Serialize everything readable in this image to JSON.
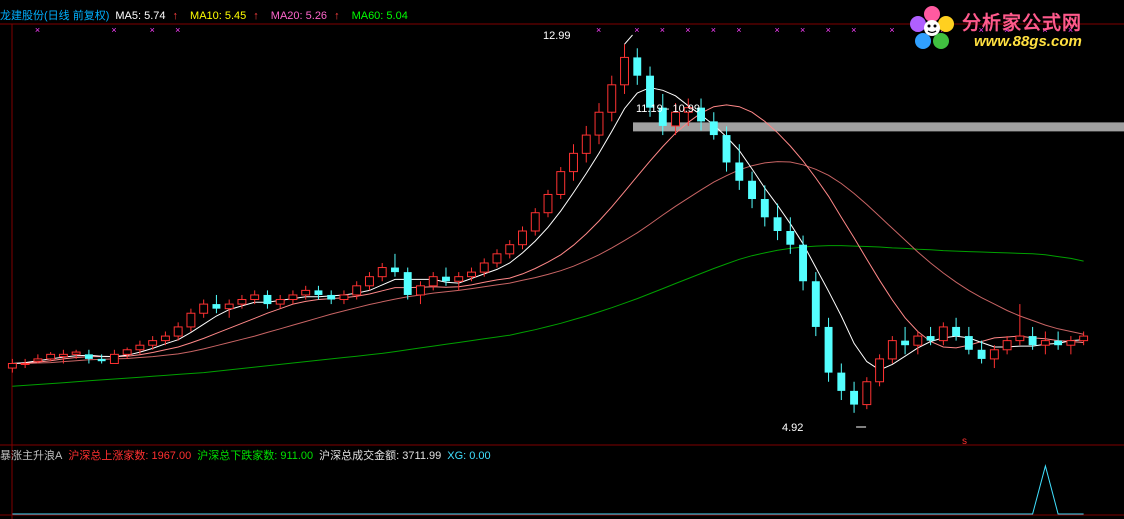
{
  "header": {
    "stock_name": "龙建股份(日线 前复权)",
    "ma5_label": "MA5: 5.74",
    "ma10_label": "MA10: 5.45",
    "ma20_label": "MA20: 5.26",
    "ma60_label": "MA60: 5.04",
    "arrow_glyph": "↑"
  },
  "logo": {
    "brand": "分析家公式网",
    "url": "www.88gs.com",
    "icon": "flower-logo-icon"
  },
  "indicator": {
    "title": "暴涨主升浪A",
    "up_label": "沪深总上涨家数: 1967.00",
    "down_label": "沪深总下跌家数: 911.00",
    "amount_label": "沪深总成交金额: 3711.99",
    "xg_label": "XG: 0.00"
  },
  "annotations": {
    "high": "12.99",
    "low": "4.92",
    "range": "11.19 - 10.99",
    "marker": "s"
  },
  "colors": {
    "bull": "#ff3232",
    "bear": "#54ffff",
    "ma5": "#ffffff",
    "ma10": "#ff8888",
    "ma20": "#c86464",
    "ma60": "#00a000",
    "grid": "#800000",
    "xmark": "#ff40ff",
    "band": "#a0a0a0",
    "xg_line": "#40e0ff"
  },
  "chart_data": {
    "type": "candlestick",
    "ylim": [
      4.5,
      13.3
    ],
    "candles": [
      [
        5.9,
        6.1,
        5.8,
        6.0
      ],
      [
        6.0,
        6.1,
        5.9,
        6.0
      ],
      [
        6.05,
        6.2,
        6.0,
        6.1
      ],
      [
        6.1,
        6.25,
        6.05,
        6.2
      ],
      [
        6.15,
        6.3,
        6.0,
        6.2
      ],
      [
        6.2,
        6.3,
        6.1,
        6.25
      ],
      [
        6.2,
        6.3,
        6.0,
        6.1
      ],
      [
        6.1,
        6.2,
        6.0,
        6.05
      ],
      [
        6.0,
        6.3,
        6.0,
        6.2
      ],
      [
        6.2,
        6.35,
        6.1,
        6.3
      ],
      [
        6.3,
        6.5,
        6.2,
        6.4
      ],
      [
        6.4,
        6.6,
        6.3,
        6.5
      ],
      [
        6.5,
        6.7,
        6.4,
        6.6
      ],
      [
        6.6,
        6.9,
        6.5,
        6.8
      ],
      [
        6.8,
        7.2,
        6.7,
        7.1
      ],
      [
        7.1,
        7.4,
        7.0,
        7.3
      ],
      [
        7.3,
        7.5,
        7.1,
        7.2
      ],
      [
        7.2,
        7.4,
        7.0,
        7.3
      ],
      [
        7.3,
        7.5,
        7.2,
        7.4
      ],
      [
        7.4,
        7.6,
        7.3,
        7.5
      ],
      [
        7.5,
        7.6,
        7.2,
        7.3
      ],
      [
        7.3,
        7.5,
        7.2,
        7.4
      ],
      [
        7.4,
        7.6,
        7.3,
        7.5
      ],
      [
        7.5,
        7.7,
        7.4,
        7.6
      ],
      [
        7.6,
        7.7,
        7.4,
        7.5
      ],
      [
        7.5,
        7.6,
        7.3,
        7.4
      ],
      [
        7.4,
        7.6,
        7.3,
        7.5
      ],
      [
        7.5,
        7.8,
        7.4,
        7.7
      ],
      [
        7.7,
        8.0,
        7.6,
        7.9
      ],
      [
        7.9,
        8.2,
        7.8,
        8.1
      ],
      [
        8.1,
        8.4,
        7.9,
        8.0
      ],
      [
        8.0,
        8.1,
        7.4,
        7.5
      ],
      [
        7.5,
        7.8,
        7.3,
        7.7
      ],
      [
        7.7,
        8.0,
        7.6,
        7.9
      ],
      [
        7.9,
        8.1,
        7.7,
        7.8
      ],
      [
        7.8,
        8.0,
        7.6,
        7.9
      ],
      [
        7.9,
        8.1,
        7.8,
        8.0
      ],
      [
        8.0,
        8.3,
        7.9,
        8.2
      ],
      [
        8.2,
        8.5,
        8.1,
        8.4
      ],
      [
        8.4,
        8.7,
        8.3,
        8.6
      ],
      [
        8.6,
        9.0,
        8.5,
        8.9
      ],
      [
        8.9,
        9.4,
        8.8,
        9.3
      ],
      [
        9.3,
        9.8,
        9.2,
        9.7
      ],
      [
        9.7,
        10.3,
        9.6,
        10.2
      ],
      [
        10.2,
        10.8,
        10.0,
        10.6
      ],
      [
        10.6,
        11.2,
        10.4,
        11.0
      ],
      [
        11.0,
        11.7,
        10.8,
        11.5
      ],
      [
        11.5,
        12.3,
        11.3,
        12.1
      ],
      [
        12.1,
        12.99,
        11.9,
        12.7
      ],
      [
        12.7,
        12.9,
        12.1,
        12.3
      ],
      [
        12.3,
        12.5,
        11.4,
        11.6
      ],
      [
        11.6,
        11.9,
        11.0,
        11.2
      ],
      [
        11.2,
        11.7,
        11.0,
        11.5
      ],
      [
        11.5,
        11.8,
        11.2,
        11.6
      ],
      [
        11.6,
        11.8,
        11.1,
        11.3
      ],
      [
        11.3,
        11.5,
        10.9,
        11.0
      ],
      [
        11.0,
        11.19,
        10.2,
        10.4
      ],
      [
        10.4,
        10.8,
        9.8,
        10.0
      ],
      [
        10.0,
        10.2,
        9.4,
        9.6
      ],
      [
        9.6,
        9.9,
        9.0,
        9.2
      ],
      [
        9.2,
        9.5,
        8.7,
        8.9
      ],
      [
        8.9,
        9.2,
        8.4,
        8.6
      ],
      [
        8.6,
        8.8,
        7.6,
        7.8
      ],
      [
        7.8,
        8.0,
        6.6,
        6.8
      ],
      [
        6.8,
        7.0,
        5.6,
        5.8
      ],
      [
        5.8,
        6.0,
        5.2,
        5.4
      ],
      [
        5.4,
        5.6,
        4.92,
        5.1
      ],
      [
        5.1,
        5.7,
        5.0,
        5.6
      ],
      [
        5.6,
        6.2,
        5.5,
        6.1
      ],
      [
        6.1,
        6.6,
        6.0,
        6.5
      ],
      [
        6.5,
        6.8,
        6.2,
        6.4
      ],
      [
        6.4,
        6.7,
        6.2,
        6.6
      ],
      [
        6.6,
        6.8,
        6.4,
        6.5
      ],
      [
        6.5,
        6.9,
        6.4,
        6.8
      ],
      [
        6.8,
        7.0,
        6.5,
        6.6
      ],
      [
        6.6,
        6.8,
        6.2,
        6.3
      ],
      [
        6.3,
        6.5,
        6.0,
        6.1
      ],
      [
        6.1,
        6.4,
        5.9,
        6.3
      ],
      [
        6.3,
        6.6,
        6.2,
        6.5
      ],
      [
        6.5,
        7.3,
        6.4,
        6.6
      ],
      [
        6.6,
        6.8,
        6.3,
        6.4
      ],
      [
        6.4,
        6.7,
        6.2,
        6.5
      ],
      [
        6.5,
        6.7,
        6.3,
        6.4
      ],
      [
        6.4,
        6.6,
        6.2,
        6.5
      ],
      [
        6.5,
        6.7,
        6.4,
        6.6
      ]
    ],
    "ma5": [
      6.0,
      6.02,
      6.06,
      6.1,
      6.14,
      6.17,
      6.18,
      6.16,
      6.15,
      6.18,
      6.25,
      6.33,
      6.43,
      6.52,
      6.68,
      6.86,
      7.04,
      7.18,
      7.26,
      7.34,
      7.34,
      7.38,
      7.42,
      7.46,
      7.46,
      7.48,
      7.5,
      7.54,
      7.6,
      7.72,
      7.84,
      7.84,
      7.84,
      7.84,
      7.78,
      7.76,
      7.86,
      7.96,
      8.06,
      8.2,
      8.42,
      8.68,
      8.98,
      9.34,
      9.74,
      10.16,
      10.6,
      11.08,
      11.58,
      11.92,
      12.04,
      11.98,
      11.86,
      11.64,
      11.44,
      11.22,
      10.96,
      10.66,
      10.26,
      9.84,
      9.46,
      9.06,
      8.62,
      8.1,
      7.58,
      7.04,
      6.44,
      6.04,
      5.86,
      5.98,
      6.16,
      6.34,
      6.48,
      6.56,
      6.6,
      6.56,
      6.46,
      6.36,
      6.36,
      6.38,
      6.38,
      6.42,
      6.44,
      6.5,
      6.52
    ],
    "ma10": [
      6.0,
      6.01,
      6.03,
      6.06,
      6.1,
      6.13,
      6.15,
      6.15,
      6.15,
      6.16,
      6.19,
      6.24,
      6.3,
      6.36,
      6.45,
      6.55,
      6.66,
      6.77,
      6.88,
      6.99,
      7.1,
      7.2,
      7.3,
      7.36,
      7.4,
      7.42,
      7.44,
      7.47,
      7.52,
      7.59,
      7.66,
      7.66,
      7.67,
      7.68,
      7.67,
      7.68,
      7.72,
      7.78,
      7.83,
      7.87,
      7.96,
      8.08,
      8.22,
      8.38,
      8.59,
      8.84,
      9.12,
      9.43,
      9.76,
      10.1,
      10.43,
      10.75,
      11.04,
      11.28,
      11.48,
      11.62,
      11.66,
      11.62,
      11.5,
      11.3,
      11.05,
      10.76,
      10.43,
      10.06,
      9.66,
      9.2,
      8.75,
      8.28,
      7.82,
      7.39,
      7.0,
      6.7,
      6.48,
      6.36,
      6.34,
      6.4,
      6.48,
      6.56,
      6.58,
      6.6,
      6.56,
      6.54,
      6.5,
      6.48,
      6.46
    ],
    "ma20": [
      6.0,
      6.0,
      6.01,
      6.02,
      6.04,
      6.06,
      6.08,
      6.09,
      6.1,
      6.11,
      6.13,
      6.15,
      6.18,
      6.21,
      6.26,
      6.32,
      6.39,
      6.46,
      6.53,
      6.6,
      6.68,
      6.76,
      6.84,
      6.92,
      7.0,
      7.08,
      7.15,
      7.22,
      7.29,
      7.35,
      7.41,
      7.46,
      7.5,
      7.54,
      7.57,
      7.6,
      7.64,
      7.68,
      7.72,
      7.76,
      7.82,
      7.88,
      7.95,
      8.03,
      8.13,
      8.25,
      8.38,
      8.53,
      8.69,
      8.86,
      9.05,
      9.25,
      9.44,
      9.62,
      9.8,
      9.97,
      10.11,
      10.24,
      10.33,
      10.39,
      10.42,
      10.41,
      10.35,
      10.25,
      10.12,
      9.94,
      9.72,
      9.48,
      9.22,
      8.96,
      8.7,
      8.44,
      8.2,
      7.98,
      7.78,
      7.6,
      7.44,
      7.3,
      7.16,
      7.04,
      6.94,
      6.84,
      6.76,
      6.7,
      6.64
    ],
    "ma60": [
      5.5,
      5.52,
      5.54,
      5.56,
      5.58,
      5.6,
      5.62,
      5.64,
      5.66,
      5.68,
      5.7,
      5.72,
      5.74,
      5.76,
      5.78,
      5.8,
      5.83,
      5.86,
      5.89,
      5.92,
      5.95,
      5.98,
      6.01,
      6.04,
      6.07,
      6.1,
      6.13,
      6.16,
      6.19,
      6.22,
      6.26,
      6.3,
      6.34,
      6.38,
      6.42,
      6.46,
      6.5,
      6.54,
      6.58,
      6.62,
      6.68,
      6.74,
      6.81,
      6.88,
      6.96,
      7.04,
      7.13,
      7.22,
      7.32,
      7.42,
      7.53,
      7.64,
      7.75,
      7.86,
      7.97,
      8.08,
      8.18,
      8.28,
      8.36,
      8.42,
      8.48,
      8.52,
      8.55,
      8.57,
      8.58,
      8.58,
      8.57,
      8.56,
      8.55,
      8.53,
      8.52,
      8.5,
      8.49,
      8.47,
      8.46,
      8.45,
      8.44,
      8.43,
      8.42,
      8.41,
      8.4,
      8.38,
      8.34,
      8.3,
      8.24
    ],
    "xg": [
      0,
      0,
      0,
      0,
      0,
      0,
      0,
      0,
      0,
      0,
      0,
      0,
      0,
      0,
      0,
      0,
      0,
      0,
      0,
      0,
      0,
      0,
      0,
      0,
      0,
      0,
      0,
      0,
      0,
      0,
      0,
      0,
      0,
      0,
      0,
      0,
      0,
      0,
      0,
      0,
      0,
      0,
      0,
      0,
      0,
      0,
      0,
      0,
      0,
      0,
      0,
      0,
      0,
      0,
      0,
      0,
      0,
      0,
      0,
      0,
      0,
      0,
      0,
      0,
      0,
      0,
      0,
      0,
      0,
      0,
      0,
      0,
      0,
      0,
      0,
      0,
      0,
      0,
      0,
      0,
      0,
      1,
      0,
      0,
      0
    ],
    "range_level": 11.19,
    "high_index": 48,
    "low_index": 66
  }
}
